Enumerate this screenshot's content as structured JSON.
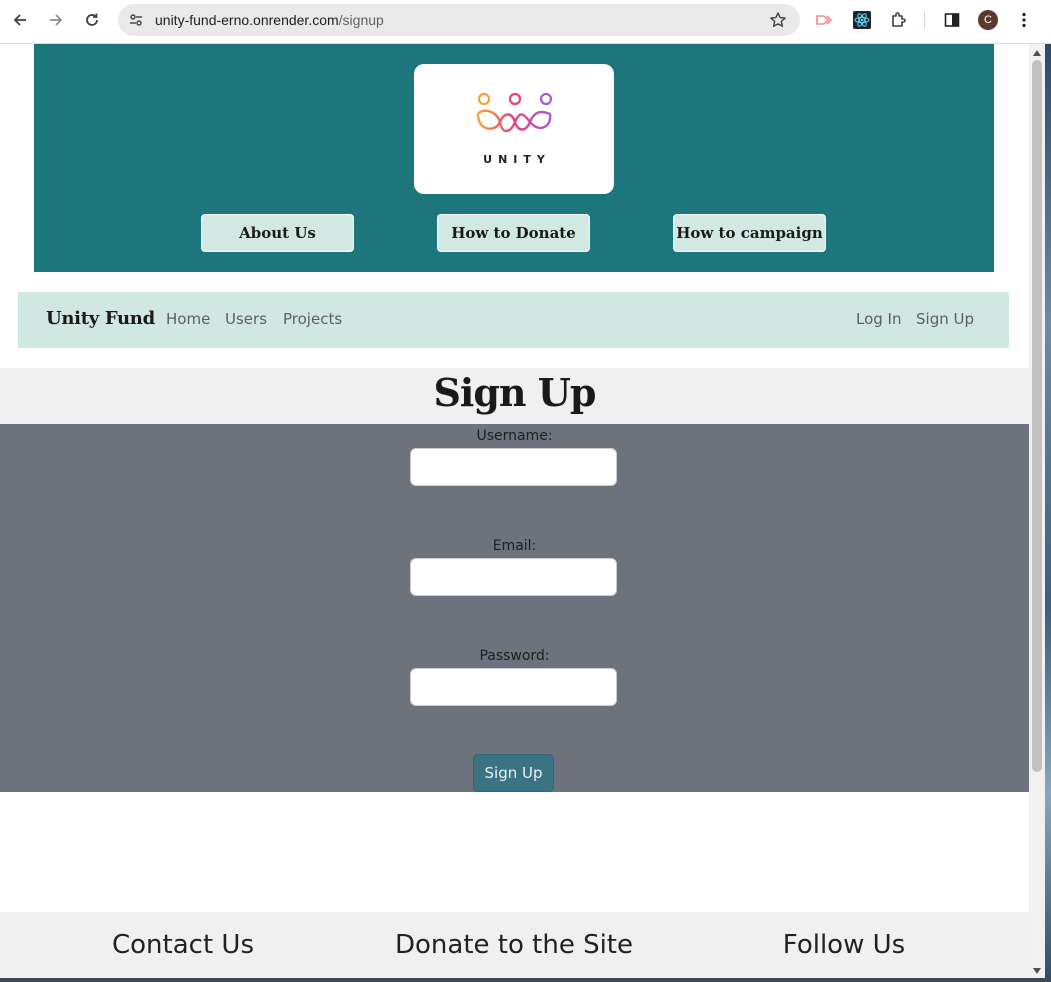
{
  "browser": {
    "url_host": "unity-fund-erno.onrender.com",
    "url_path": "/signup",
    "profile_initial": "C",
    "icons": [
      "back-arrow-icon",
      "forward-arrow-icon",
      "reload-icon",
      "site-settings-icon",
      "bookmark-star-icon",
      "media-extension-icon",
      "react-devtools-icon",
      "extensions-puzzle-icon",
      "side-panel-icon",
      "more-menu-icon"
    ]
  },
  "hero": {
    "logo_text": "UNITY",
    "buttons": [
      "About Us",
      "How to Donate",
      "How to campaign"
    ]
  },
  "navbar": {
    "brand": "Unity Fund",
    "left_links": [
      "Home",
      "Users",
      "Projects"
    ],
    "right_links": [
      "Log In",
      "Sign Up"
    ]
  },
  "signup": {
    "title": "Sign Up",
    "fields": [
      {
        "label": "Username:",
        "value": ""
      },
      {
        "label": "Email:",
        "value": ""
      },
      {
        "label": "Password:",
        "value": ""
      }
    ],
    "submit_label": "Sign Up"
  },
  "footer": {
    "headings": [
      "Contact Us",
      "Donate to the Site",
      "Follow Us"
    ]
  },
  "colors": {
    "hero_bg": "#1c767c",
    "navbar_bg": "#d1e7e2",
    "form_bg": "#6d737d",
    "submit_bg": "#3a7483",
    "logo_orange": "#f2a33a",
    "logo_pink": "#e7407e",
    "logo_purple": "#a45bd8"
  }
}
